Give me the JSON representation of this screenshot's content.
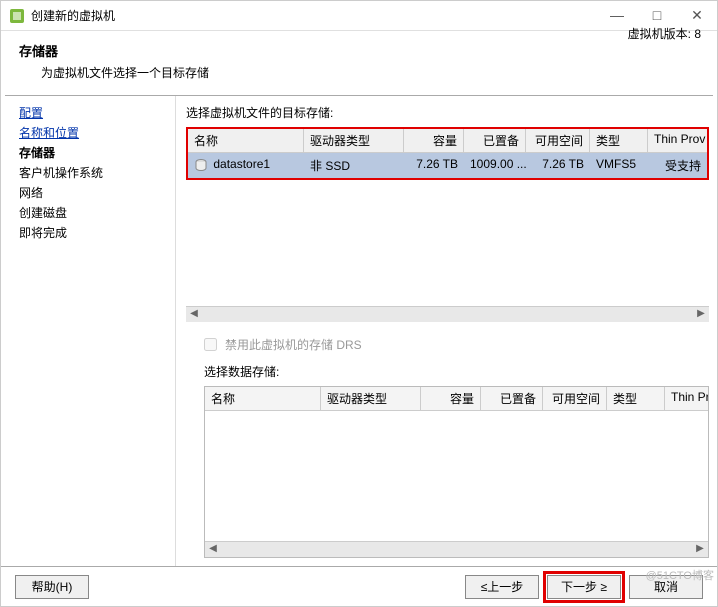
{
  "titlebar": {
    "title": "创建新的虚拟机",
    "min": "—",
    "max": "□",
    "close": "✕"
  },
  "header": {
    "title": "存储器",
    "subtitle": "为虚拟机文件选择一个目标存储",
    "version": "虚拟机版本: 8"
  },
  "sidebar": {
    "items": [
      {
        "label": "配置",
        "link": true
      },
      {
        "label": "名称和位置",
        "link": true
      },
      {
        "label": "存储器",
        "active": true
      },
      {
        "label": "客户机操作系统"
      },
      {
        "label": "网络"
      },
      {
        "label": "创建磁盘"
      },
      {
        "label": "即将完成"
      }
    ]
  },
  "main": {
    "section1_label": "选择虚拟机文件的目标存储:",
    "columns": {
      "name": "名称",
      "drive": "驱动器类型",
      "capacity": "容量",
      "provisioned": "已置备",
      "free": "可用空间",
      "type": "类型",
      "thin": "Thin Prov"
    },
    "rows": [
      {
        "name": "datastore1",
        "drive": "非 SSD",
        "capacity": "7.26 TB",
        "provisioned": "1009.00 ...",
        "free": "7.26 TB",
        "type": "VMFS5",
        "thin": "受支持"
      }
    ],
    "drs_label": "禁用此虚拟机的存储 DRS",
    "section2_label": "选择数据存储:",
    "columns2": {
      "name": "名称",
      "drive": "驱动器类型",
      "capacity": "容量",
      "provisioned": "已置备",
      "free": "可用空间",
      "type": "类型",
      "thin": "Thin Provi"
    }
  },
  "footer": {
    "help": "帮助(H)",
    "prev": "≤上一步",
    "next": "下一步 ≥",
    "cancel": "取消"
  },
  "watermark": "@51CTO博客"
}
